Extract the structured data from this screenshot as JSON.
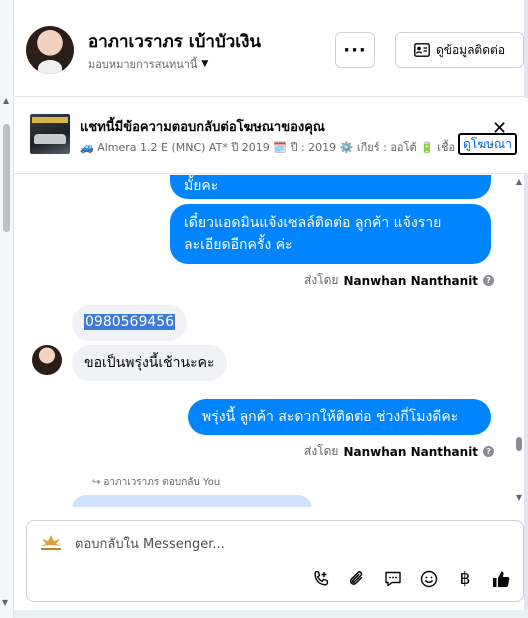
{
  "header": {
    "name": "อาภาเวราภร เบ้าบัวเงิน",
    "assign_label": "มอบหมายการสนทนานี้",
    "more_label": "···",
    "contact_label": "ดูข้อมูลติดต่อ"
  },
  "ad": {
    "title": "แชทนี้มีข้อความตอบกลับต่อโฆษณาของคุณ",
    "subtitle": "🚙 Almera 1.2 E (MNC) AT* ปี 2019 🗓️ ปี : 2019 ⚙️ เกียร์ : ออโต้ 🔋 เชื้อ",
    "view_label": "ดูโฆษณา",
    "close_label": "✕"
  },
  "messages": {
    "out1_tail": "มั้ยคะ",
    "out2": "เดี๋ยวแอดมินแจ้งเซลล์ติดต่อ ลูกค้า  แจ้งรายละเอียดอีกครั้ง ค่ะ",
    "sent_prefix": "ส่งโดย",
    "sender": "Nanwhan Nanthanit",
    "in_phone": "0980569456",
    "in2": "ขอเป็นพรุ่งนี้เช้านะคะ",
    "out3": "พรุ่งนี้ ลูกค้า  สะดวกให้ติดต่อ ช่วงกี่โมงดีคะ",
    "reply_meta": "อาภาเวราภร ตอบกลับ You"
  },
  "composer": {
    "placeholder": "ตอบกลับใน Messenger...",
    "baht_symbol": "฿"
  },
  "colors": {
    "accent": "#0084ff",
    "incoming": "#f0f2f5",
    "highlight": "#3e7bd6"
  }
}
